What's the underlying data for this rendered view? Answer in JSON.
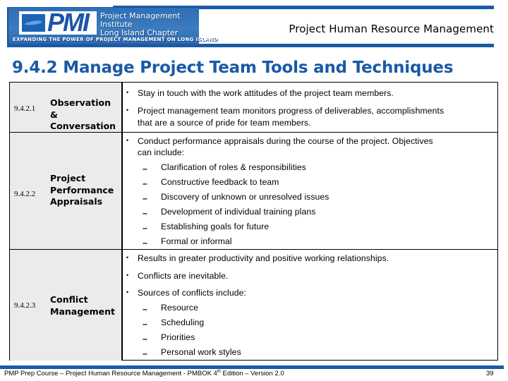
{
  "header": {
    "logo": {
      "icon": "pmi-logo-icon",
      "letters": "PMI",
      "org_line1": "Project Management Institute",
      "org_line2": "Long Island Chapter",
      "tagline": "EXPANDING THE POWER OF PROJECT MANAGEMENT ON LONG ISLAND"
    },
    "title": "Project Human Resource Management"
  },
  "slide": {
    "title": "9.4.2 Manage Project Team Tools and Techniques"
  },
  "table": {
    "rows": [
      {
        "number": "9.4.2.1",
        "name_lines": [
          "Observation &",
          "Conversation"
        ],
        "items": [
          {
            "type": "bullet",
            "lines": [
              "Stay in touch with the work attitudes of the project team members."
            ]
          },
          {
            "type": "bullet",
            "lines": [
              "Project management team monitors progress of deliverables, accomplishments",
              "that are a source of pride for team members."
            ]
          }
        ]
      },
      {
        "number": "9.4.2.2",
        "name_lines": [
          "Project",
          "Performance",
          "Appraisals"
        ],
        "items": [
          {
            "type": "bullet",
            "lines": [
              "Conduct performance appraisals during the course of the project. Objectives",
              "can include:"
            ]
          },
          {
            "type": "sub",
            "lines": [
              "Clarification of roles & responsibilities"
            ]
          },
          {
            "type": "sub",
            "lines": [
              "Constructive feedback to team"
            ]
          },
          {
            "type": "sub",
            "lines": [
              "Discovery of unknown or unresolved issues"
            ]
          },
          {
            "type": "sub",
            "lines": [
              "Development of individual training plans"
            ]
          },
          {
            "type": "sub",
            "lines": [
              "Establishing goals for future"
            ]
          },
          {
            "type": "sub",
            "lines": [
              "Formal or informal"
            ]
          }
        ]
      },
      {
        "number": "9.4.2.3",
        "name_lines": [
          "Conflict",
          "Management"
        ],
        "items": [
          {
            "type": "bullet",
            "lines": [
              "Results in greater productivity and positive working relationships."
            ]
          },
          {
            "type": "bullet",
            "lines": [
              "Conflicts are inevitable."
            ]
          },
          {
            "type": "bullet",
            "lines": [
              "Sources of conflicts include:"
            ]
          },
          {
            "type": "sub",
            "lines": [
              "Resource"
            ]
          },
          {
            "type": "sub",
            "lines": [
              "Scheduling"
            ]
          },
          {
            "type": "sub",
            "lines": [
              "Priorities"
            ]
          },
          {
            "type": "sub",
            "lines": [
              "Personal work styles"
            ]
          }
        ]
      }
    ],
    "bullet_glyph": "•",
    "sub_glyph": "–"
  },
  "footer": {
    "text_before_sup": "PMP Prep Course – Project Human Resource Management - PMBOK 4",
    "sup": "th",
    "text_after_sup": " Edition – Version 2.0",
    "page_number": "39"
  },
  "colors": {
    "brand_blue": "#1a5aa6",
    "cell_gray": "#ebebeb"
  }
}
